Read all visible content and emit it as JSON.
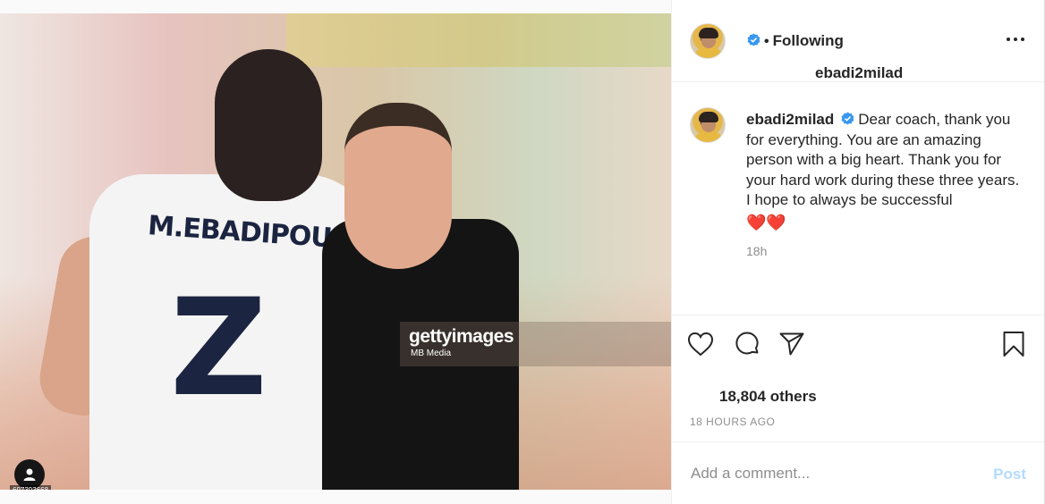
{
  "post": {
    "media": {
      "jersey_name": "M.EBADIPOUR",
      "jersey_number": "Z",
      "watermark": {
        "brand": "gettyimages",
        "credit": "MB Media"
      },
      "photo_id": "697393668"
    },
    "header": {
      "username": "ebadi2milad",
      "separator": "•",
      "follow_status": "Following"
    },
    "caption": {
      "username": "ebadi2milad",
      "text": "Dear coach, thank you for everything. You are an amazing person with a big heart. Thank you for your hard work during these three years. I hope to always be successful",
      "emoji": "❤️❤️",
      "time_ago": "18h"
    },
    "actions": {
      "icons": [
        "heart-icon",
        "comment-icon",
        "share-icon",
        "bookmark-icon"
      ]
    },
    "likes": {
      "text": "18,804 others"
    },
    "timestamp": "18 HOURS AGO",
    "comment": {
      "placeholder": "Add a comment...",
      "post_label": "Post"
    },
    "colors": {
      "verified": "#3897f0",
      "link_disabled": "#b3dbff",
      "muted": "#8e8e8e",
      "heart": "#e0245e"
    }
  }
}
